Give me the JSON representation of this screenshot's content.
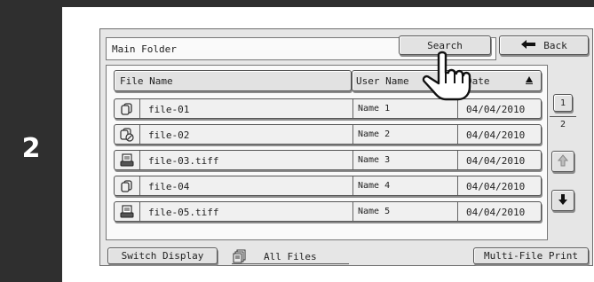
{
  "step": {
    "number": "2"
  },
  "folder": {
    "title": "Main Folder"
  },
  "toolbar": {
    "search_label": "Search",
    "back_label": "Back"
  },
  "columns": {
    "file_name": "File Name",
    "user_name": "User Name",
    "date": "Date",
    "date_sort_icon": "sort-ascending-triangle"
  },
  "files": [
    {
      "name": "file-01",
      "user": "Name 1",
      "date": "04/04/2010",
      "icon": "copy-job-icon"
    },
    {
      "name": "file-02",
      "user": "Name 2",
      "date": "04/04/2010",
      "icon": "copy-job-prohibited-icon"
    },
    {
      "name": "file-03.tiff",
      "user": "Name 3",
      "date": "04/04/2010",
      "icon": "scan-file-icon"
    },
    {
      "name": "file-04",
      "user": "Name 4",
      "date": "04/04/2010",
      "icon": "copy-job-icon"
    },
    {
      "name": "file-05.tiff",
      "user": "Name 5",
      "date": "04/04/2010",
      "icon": "scan-file-icon"
    }
  ],
  "pagination": {
    "current": "1",
    "total": "2"
  },
  "bottom": {
    "switch_display": "Switch Display",
    "filter": "All Files",
    "multi_file_print": "Multi-File Print"
  }
}
